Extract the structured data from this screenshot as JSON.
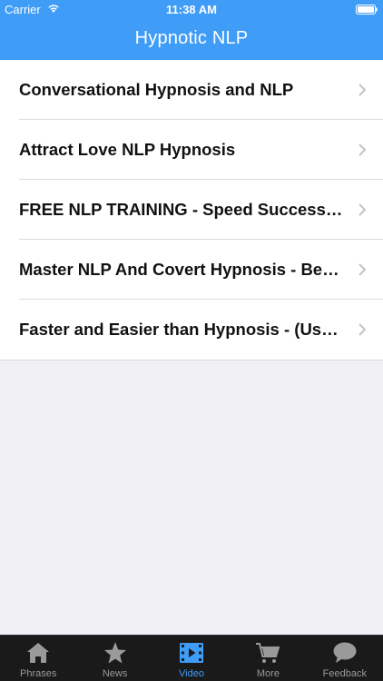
{
  "status_bar": {
    "carrier": "Carrier",
    "time": "11:38 AM"
  },
  "nav": {
    "title": "Hypnotic NLP"
  },
  "list": {
    "items": [
      {
        "label": "Conversational Hypnosis and NLP"
      },
      {
        "label": "Attract Love NLP Hypnosis"
      },
      {
        "label": "FREE NLP TRAINING - Speed Success S..."
      },
      {
        "label": "Master NLP And Covert Hypnosis - Beco..."
      },
      {
        "label": "Faster and Easier than Hypnosis - (Used..."
      }
    ]
  },
  "tab_bar": {
    "tabs": [
      {
        "label": "Phrases",
        "icon": "house-icon"
      },
      {
        "label": "News",
        "icon": "star-icon"
      },
      {
        "label": "Video",
        "icon": "film-icon",
        "active": true
      },
      {
        "label": "More",
        "icon": "cart-icon"
      },
      {
        "label": "Feedback",
        "icon": "speech-bubble-icon"
      }
    ]
  },
  "colors": {
    "accent": "#3f9cf7",
    "tab_bar_bg": "#1a1a1a",
    "background": "#efeff4"
  }
}
